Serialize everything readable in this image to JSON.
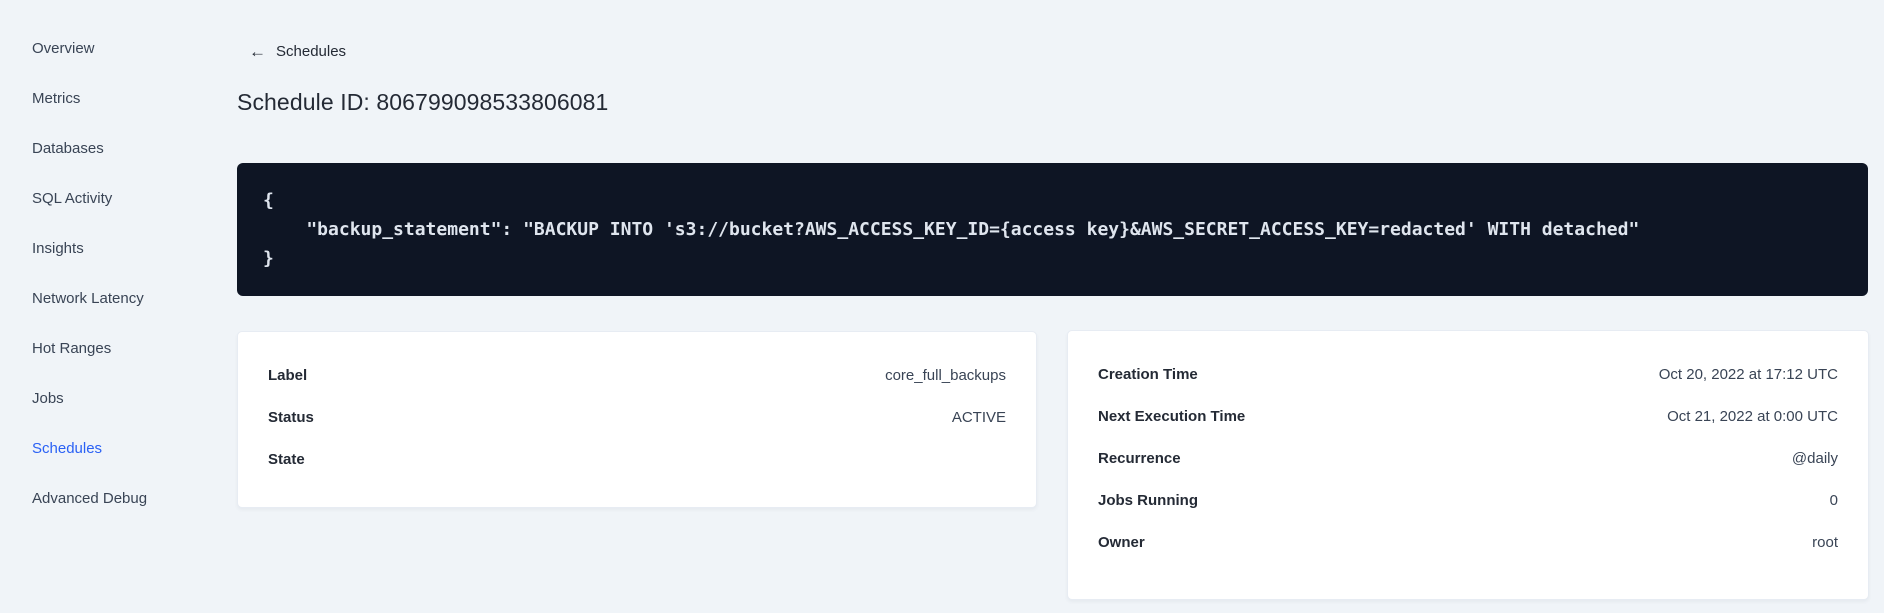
{
  "sidebar": {
    "items": [
      {
        "label": "Overview"
      },
      {
        "label": "Metrics"
      },
      {
        "label": "Databases"
      },
      {
        "label": "SQL Activity"
      },
      {
        "label": "Insights"
      },
      {
        "label": "Network Latency"
      },
      {
        "label": "Hot Ranges"
      },
      {
        "label": "Jobs"
      },
      {
        "label": "Schedules",
        "active": true
      },
      {
        "label": "Advanced Debug"
      }
    ]
  },
  "header": {
    "back_label": "Schedules",
    "back_icon": "arrow-left",
    "title": "Schedule ID: 806799098533806081"
  },
  "code_block": {
    "text": "{\n    \"backup_statement\": \"BACKUP INTO 's3://bucket?AWS_ACCESS_KEY_ID={access key}&AWS_SECRET_ACCESS_KEY=redacted' WITH detached\"\n}"
  },
  "details_card": {
    "rows": [
      {
        "label": "Label",
        "value": "core_full_backups"
      },
      {
        "label": "Status",
        "value": "ACTIVE"
      },
      {
        "label": "State",
        "value": ""
      }
    ]
  },
  "schedule_card": {
    "rows": [
      {
        "label": "Creation Time",
        "value": "Oct 20, 2022 at 17:12 UTC"
      },
      {
        "label": "Next Execution Time",
        "value": "Oct 21, 2022 at 0:00 UTC"
      },
      {
        "label": "Recurrence",
        "value": "@daily"
      },
      {
        "label": "Jobs Running",
        "value": "0"
      },
      {
        "label": "Owner",
        "value": "root"
      }
    ]
  },
  "colors": {
    "page_bg": "#f0f4f8",
    "accent_blue": "#2a61f5",
    "code_bg": "#0e1524",
    "code_text": "#dfe5ee",
    "text_dark": "#242a35"
  }
}
